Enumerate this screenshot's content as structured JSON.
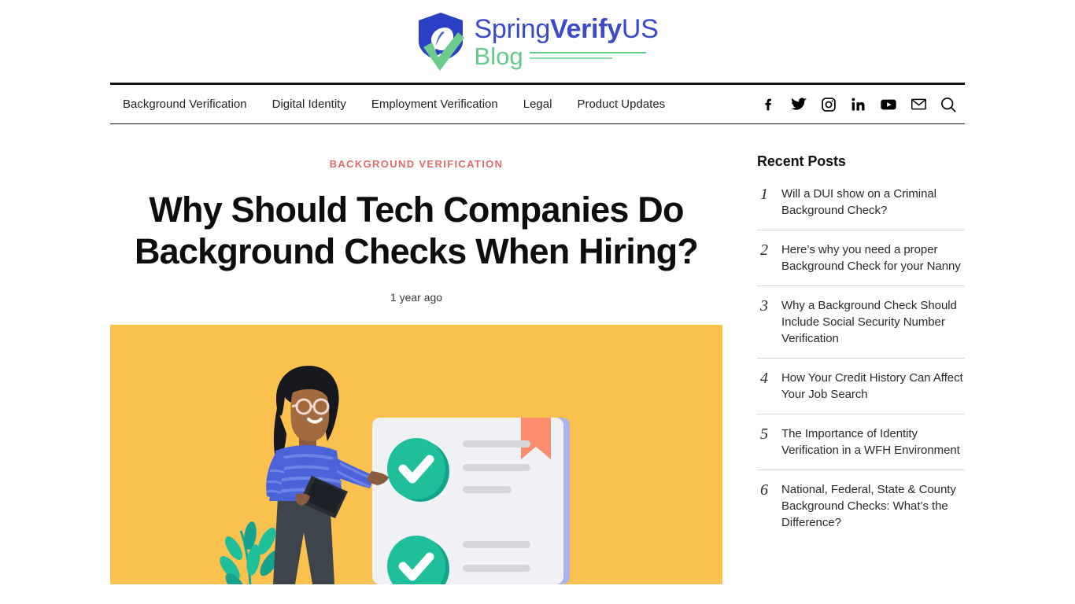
{
  "site": {
    "logo": {
      "brand_part1": "Spring",
      "brand_part2": "Verify",
      "brand_part3": "US",
      "sub_label": "Blog",
      "shield_icon": "shield-leaf-check-icon",
      "colors": {
        "brand_blue": "#3B4BC8",
        "brand_green": "#64C98A"
      }
    }
  },
  "nav": {
    "links": [
      {
        "label": "Background Verification"
      },
      {
        "label": "Digital Identity"
      },
      {
        "label": "Employment Verification"
      },
      {
        "label": "Legal"
      },
      {
        "label": "Product Updates"
      }
    ],
    "icons": [
      {
        "name": "facebook-icon",
        "label": "Facebook"
      },
      {
        "name": "twitter-icon",
        "label": "Twitter"
      },
      {
        "name": "instagram-icon",
        "label": "Instagram"
      },
      {
        "name": "linkedin-icon",
        "label": "LinkedIn"
      },
      {
        "name": "youtube-icon",
        "label": "YouTube"
      },
      {
        "name": "email-icon",
        "label": "Email"
      },
      {
        "name": "search-icon",
        "label": "Search"
      }
    ]
  },
  "article": {
    "category": "BACKGROUND VERIFICATION",
    "category_color": "#e06b6b",
    "title": "Why Should Tech Companies Do Background Checks When Hiring?",
    "date": "1 year ago",
    "hero": {
      "alt": "Illustration of a woman pointing at a checklist document with green check marks",
      "background_color": "#FBC14E",
      "accent_teal": "#1FBF9C",
      "card_color": "#F0F1F4",
      "ribbon_color": "#FB8C6E",
      "sweater_color": "#4A63D8"
    }
  },
  "sidebar": {
    "title": "Recent Posts",
    "posts": [
      {
        "num": "1",
        "title": "Will a DUI show on a Criminal Background Check?"
      },
      {
        "num": "2",
        "title": "Here’s why you need a proper Background Check for your Nanny"
      },
      {
        "num": "3",
        "title": "Why a Background Check Should Include Social Security Number Verification"
      },
      {
        "num": "4",
        "title": "How Your Credit History Can Affect Your Job Search"
      },
      {
        "num": "5",
        "title": "The Importance of Identity Verification in a WFH Environment"
      },
      {
        "num": "6",
        "title": "National, Federal, State & County Background Checks: What’s the Difference?"
      }
    ]
  }
}
